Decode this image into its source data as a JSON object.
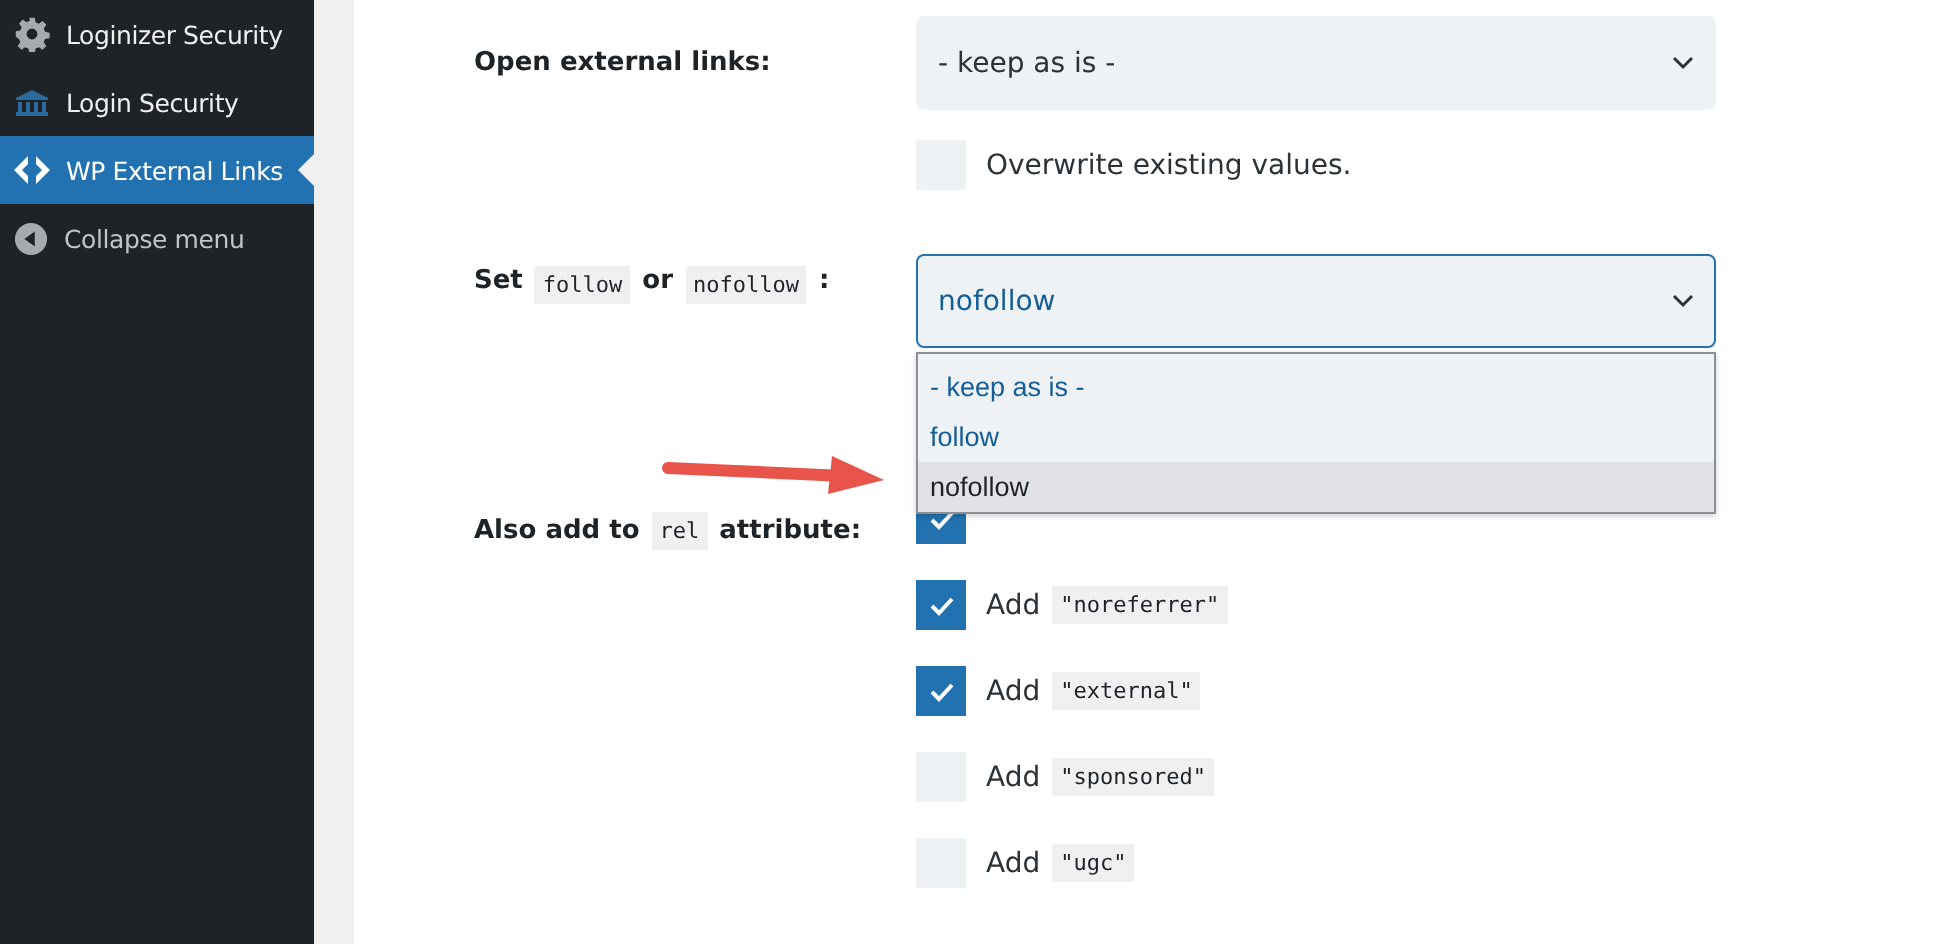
{
  "sidebar": {
    "items": [
      {
        "label": "Loginizer Security",
        "selected": false
      },
      {
        "label": "Login Security",
        "selected": false
      },
      {
        "label": "WP External Links",
        "selected": true
      },
      {
        "label": "Collapse menu",
        "selected": false
      }
    ]
  },
  "open_links": {
    "label": "Open external links:",
    "value": "- keep as is -",
    "overwrite": {
      "label": "Overwrite existing values.",
      "checked": false
    }
  },
  "follow": {
    "label_parts": [
      {
        "kind": "text",
        "text": "Set"
      },
      {
        "kind": "code",
        "text": "follow"
      },
      {
        "kind": "text",
        "text": "or"
      },
      {
        "kind": "code",
        "text": "nofollow"
      },
      {
        "kind": "text",
        "text": ":"
      }
    ],
    "value": "nofollow",
    "expanded": true,
    "options": [
      {
        "label": "- keep as is -",
        "selected": false
      },
      {
        "label": "follow",
        "selected": false
      },
      {
        "label": "nofollow",
        "selected": true
      }
    ]
  },
  "rel": {
    "label_parts": [
      {
        "kind": "text",
        "text": "Also add to"
      },
      {
        "kind": "code",
        "text": "rel"
      },
      {
        "kind": "text",
        "text": "attribute:"
      }
    ],
    "options": [
      {
        "checked": true
      },
      {
        "label": "Add",
        "code": "\"noreferrer\"",
        "checked": true
      },
      {
        "label": "Add",
        "code": "\"external\"",
        "checked": true
      },
      {
        "label": "Add",
        "code": "\"sponsored\"",
        "checked": false
      },
      {
        "label": "Add",
        "code": "\"ugc\"",
        "checked": false
      }
    ]
  }
}
